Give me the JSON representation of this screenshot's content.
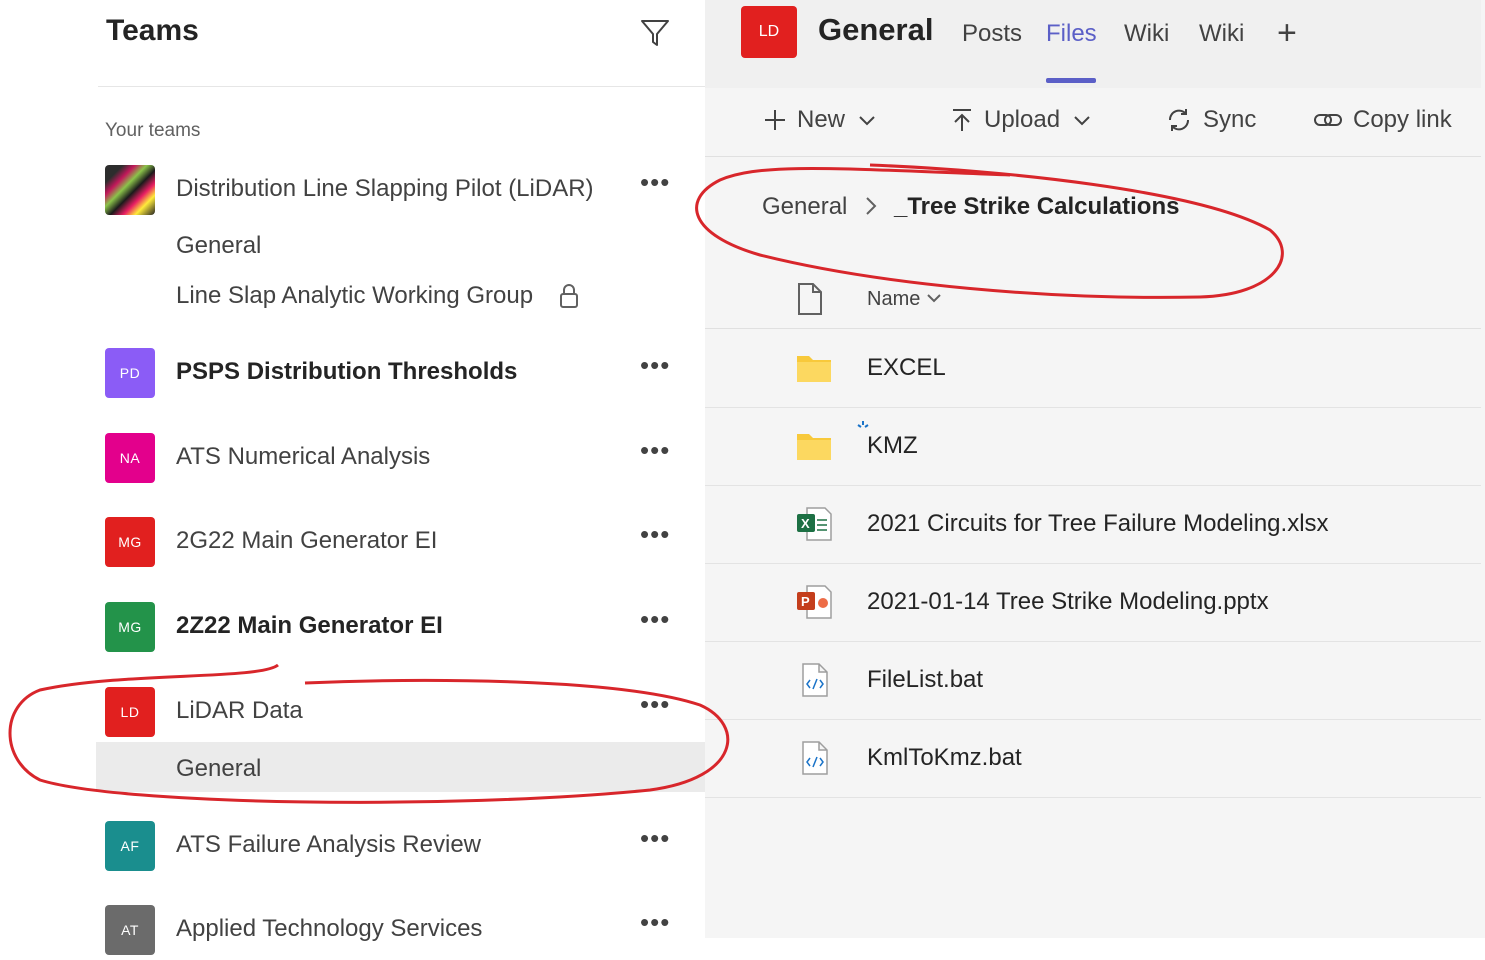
{
  "left": {
    "title": "Teams",
    "section_label": "Your teams",
    "teams": [
      {
        "name": "Distribution Line Slapping Pilot (LiDAR)",
        "initials": "",
        "color": "#333333",
        "bold": false
      },
      {
        "name": "PSPS Distribution Thresholds",
        "initials": "PD",
        "color": "#8b5cf6",
        "bold": true
      },
      {
        "name": "ATS Numerical Analysis",
        "initials": "NA",
        "color": "#e3008c",
        "bold": false
      },
      {
        "name": "2G22 Main Generator EI",
        "initials": "MG",
        "color": "#e1201f",
        "bold": false
      },
      {
        "name": "2Z22 Main Generator EI",
        "initials": "MG",
        "color": "#23934a",
        "bold": true
      },
      {
        "name": "LiDAR Data",
        "initials": "LD",
        "color": "#e1201f",
        "bold": false
      },
      {
        "name": "ATS Failure Analysis Review",
        "initials": "AF",
        "color": "#1a8e8e",
        "bold": false
      },
      {
        "name": "Applied Technology Services",
        "initials": "AT",
        "color": "#6b6b6b",
        "bold": false
      }
    ],
    "channels": {
      "pilot_general": "General",
      "pilot_private": "Line Slap Analytic Working Group",
      "lidar_general": "General"
    },
    "more_label": "•••"
  },
  "right": {
    "channel_initials": "LD",
    "channel_color": "#e1201f",
    "channel_title": "General",
    "tabs": [
      "Posts",
      "Files",
      "Wiki",
      "Wiki"
    ],
    "active_tab": "Files",
    "add_tab": "+",
    "toolbar": {
      "new": "New",
      "upload": "Upload",
      "sync": "Sync",
      "copy_link": "Copy link"
    },
    "breadcrumb": {
      "root": "General",
      "current": "_Tree Strike Calculations"
    },
    "column_name": "Name",
    "files": [
      {
        "name": "EXCEL",
        "type": "folder"
      },
      {
        "name": "KMZ",
        "type": "folder"
      },
      {
        "name": "2021 Circuits for Tree Failure Modeling.xlsx",
        "type": "xlsx"
      },
      {
        "name": "2021-01-14 Tree Strike Modeling.pptx",
        "type": "pptx"
      },
      {
        "name": "FileList.bat",
        "type": "bat"
      },
      {
        "name": "KmlToKmz.bat",
        "type": "bat"
      }
    ]
  },
  "colors": {
    "accent": "#5b5fc7",
    "annotation": "#d8262b"
  }
}
